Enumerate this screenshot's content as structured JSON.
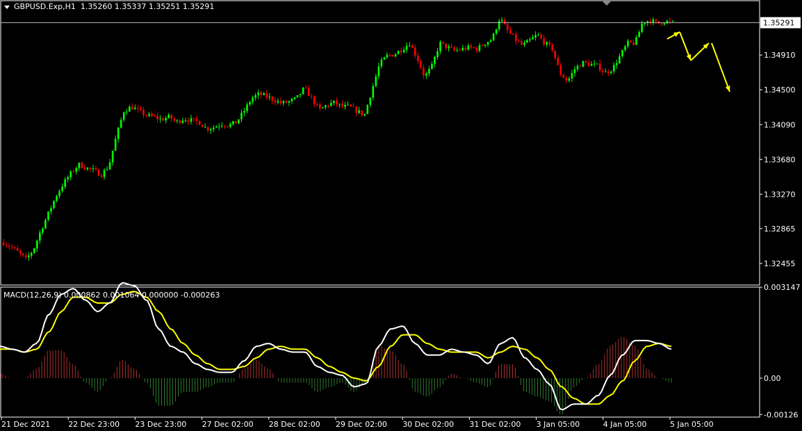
{
  "header": {
    "symbol": "GBPUSD.Exp,H1",
    "open": "1.35260",
    "high": "1.35337",
    "low": "1.35251",
    "close": "1.35291"
  },
  "macd": {
    "label": "MACD(12,26,9)",
    "main": "0.000862",
    "signal": "0.001064",
    "v3": "0.000000",
    "v4": "-0.000263"
  },
  "colors": {
    "background": "#000000",
    "bull": "#00ff00",
    "bear": "#ff0000",
    "macd_line": "#ffffff",
    "signal_line": "#ffff00",
    "arrows": "#ffff00",
    "hist_pos": "#b03030",
    "hist_neg": "#2f7a2f",
    "grid": "#ffffff"
  },
  "chart_data": [
    {
      "type": "candlestick",
      "title": "GBPUSD.Exp,H1",
      "current_price": 1.35291,
      "current_price_label": "1.35291",
      "y_ticks": [
        "1.34910",
        "1.34500",
        "1.34090",
        "1.33680",
        "1.33270",
        "1.32865",
        "1.32455"
      ],
      "ylim": [
        1.322,
        1.3555
      ],
      "x_ticks": [
        "21 Dec 2021",
        "22 Dec 23:00",
        "23 Dec 23:00",
        "27 Dec 02:00",
        "28 Dec 02:00",
        "29 Dec 02:00",
        "30 Dec 02:00",
        "31 Dec 02:00",
        "3 Jan 05:00",
        "4 Jan 05:00",
        "5 Jan 05:00"
      ],
      "close_path": [
        1.327,
        1.3265,
        1.3258,
        1.325,
        1.3262,
        1.3285,
        1.3305,
        1.3325,
        1.334,
        1.3352,
        1.3362,
        1.3358,
        1.3355,
        1.335,
        1.336,
        1.3395,
        1.3425,
        1.343,
        1.3425,
        1.342,
        1.3418,
        1.3415,
        1.3418,
        1.3412,
        1.3416,
        1.3414,
        1.3412,
        1.3404,
        1.3406,
        1.341,
        1.3408,
        1.3412,
        1.3425,
        1.344,
        1.3445,
        1.3442,
        1.3438,
        1.3434,
        1.3436,
        1.344,
        1.3452,
        1.344,
        1.3426,
        1.3432,
        1.3435,
        1.343,
        1.343,
        1.3425,
        1.342,
        1.345,
        1.348,
        1.349,
        1.3492,
        1.3498,
        1.3505,
        1.3488,
        1.3465,
        1.3478,
        1.3505,
        1.35,
        1.3496,
        1.3498,
        1.35,
        1.3498,
        1.3505,
        1.351,
        1.3535,
        1.352,
        1.351,
        1.3502,
        1.3508,
        1.3515,
        1.3505,
        1.3498,
        1.347,
        1.346,
        1.3475,
        1.3482,
        1.348,
        1.3478,
        1.347,
        1.3475,
        1.349,
        1.3505,
        1.3505,
        1.353,
        1.3532,
        1.3528,
        1.3531,
        1.3529
      ],
      "projection_arrows": [
        {
          "from": "1.35291",
          "to": "1.35240",
          "direction": "down"
        },
        {
          "from": "1.35240",
          "to": "1.35280",
          "direction": "up"
        },
        {
          "from": "1.35280",
          "to": "1.34680",
          "direction": "down"
        }
      ]
    },
    {
      "type": "line",
      "title": "MACD(12,26,9) 0.000862 0.001064 0.000000 -0.000263",
      "y_ticks": [
        "0.003147",
        "0.00",
        "-0.00126"
      ],
      "ylim": [
        -0.00135,
        0.00315
      ],
      "series": [
        {
          "name": "MACD",
          "color": "#ffffff",
          "values": [
            0.0011,
            0.001,
            0.0009,
            0.0012,
            0.0022,
            0.0029,
            0.0031,
            0.0027,
            0.0023,
            0.0026,
            0.0033,
            0.0032,
            0.0027,
            0.0017,
            0.0011,
            0.0009,
            0.0005,
            0.0003,
            0.0002,
            0.0002,
            0.0006,
            0.0011,
            0.0012,
            0.001,
            0.0009,
            0.0009,
            0.0004,
            0.0002,
            0.0001,
            -0.0003,
            -0.0002,
            0.0011,
            0.0017,
            0.0018,
            0.0012,
            0.0008,
            0.0008,
            0.001,
            0.0009,
            0.0008,
            0.0005,
            0.0012,
            0.0014,
            0.0007,
            0.0003,
            -0.0002,
            -0.0011,
            -0.0009,
            -0.0009,
            -0.0006,
            0.0001,
            0.0008,
            0.0013,
            0.0013,
            0.0012,
            0.001
          ]
        },
        {
          "name": "Signal",
          "color": "#ffff00",
          "values": [
            0.001,
            0.001,
            0.0009,
            0.001,
            0.0016,
            0.0023,
            0.0028,
            0.0028,
            0.0026,
            0.0026,
            0.0029,
            0.003,
            0.0028,
            0.0023,
            0.0017,
            0.0012,
            0.0008,
            0.0005,
            0.0003,
            0.0003,
            0.0004,
            0.0007,
            0.001,
            0.0011,
            0.001,
            0.001,
            0.0007,
            0.0004,
            0.0002,
            0.0,
            -0.0001,
            0.0004,
            0.0011,
            0.0015,
            0.0015,
            0.0012,
            0.001,
            0.0009,
            0.0009,
            0.0009,
            0.0007,
            0.0009,
            0.0011,
            0.001,
            0.0007,
            0.0003,
            -0.0003,
            -0.0007,
            -0.0009,
            -0.0009,
            -0.0006,
            -0.0001,
            0.0006,
            0.0011,
            0.0012,
            0.0011
          ]
        }
      ]
    }
  ]
}
